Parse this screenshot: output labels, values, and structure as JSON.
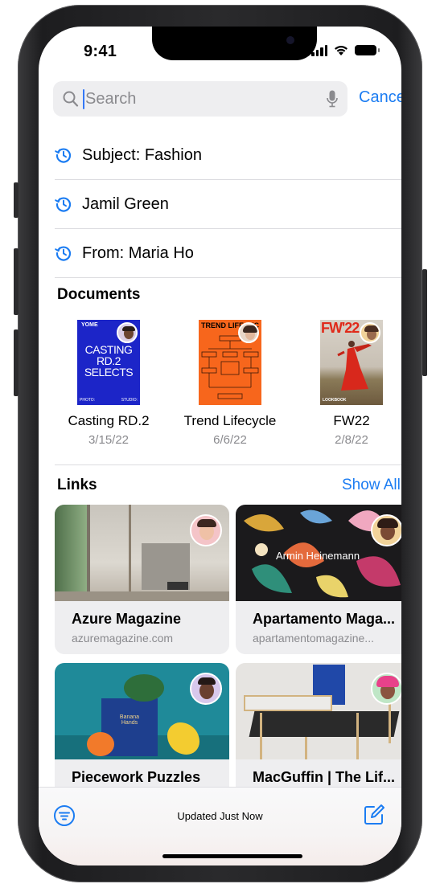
{
  "status_bar": {
    "time": "9:41"
  },
  "search": {
    "placeholder": "Search",
    "value": "",
    "cancel_label": "Cancel"
  },
  "recents": [
    {
      "label": "Subject: Fashion",
      "icon": "history-icon"
    },
    {
      "label": "Jamil Green",
      "icon": "history-icon"
    },
    {
      "label": "From: Maria Ho",
      "icon": "history-icon"
    }
  ],
  "documents": {
    "title": "Documents",
    "items": [
      {
        "name": "Casting RD.2",
        "date": "3/15/22",
        "thumb_header": "YOME",
        "thumb_text": [
          "CASTING",
          "RD.2",
          "SELECTS"
        ],
        "thumb_footer_left": "PHOTO:",
        "thumb_footer_right": "STUDIO:"
      },
      {
        "name": "Trend Lifecycle",
        "date": "6/6/22",
        "thumb_header": "TREND LIFECYC"
      },
      {
        "name": "FW22",
        "date": "2/8/22",
        "thumb_header": "FW'22",
        "thumb_footer": "LOOKBOOK"
      }
    ]
  },
  "links": {
    "title": "Links",
    "show_all_label": "Show All",
    "items": [
      {
        "title": "Azure Magazine",
        "url": "azuremagazine.com"
      },
      {
        "title": "Apartamento Maga...",
        "url": "apartamentomagazine...",
        "overlay": "Armin Heinemann"
      },
      {
        "title": "Piecework Puzzles",
        "url": "",
        "overlay": "Banana Hands"
      },
      {
        "title": "MacGuffin | The Lif...",
        "url": ""
      }
    ]
  },
  "toolbar": {
    "status": "Updated Just Now"
  },
  "colors": {
    "accent": "#1b7cf2",
    "secondary_text": "#8a8a8e",
    "field_bg": "#eeeef0"
  }
}
